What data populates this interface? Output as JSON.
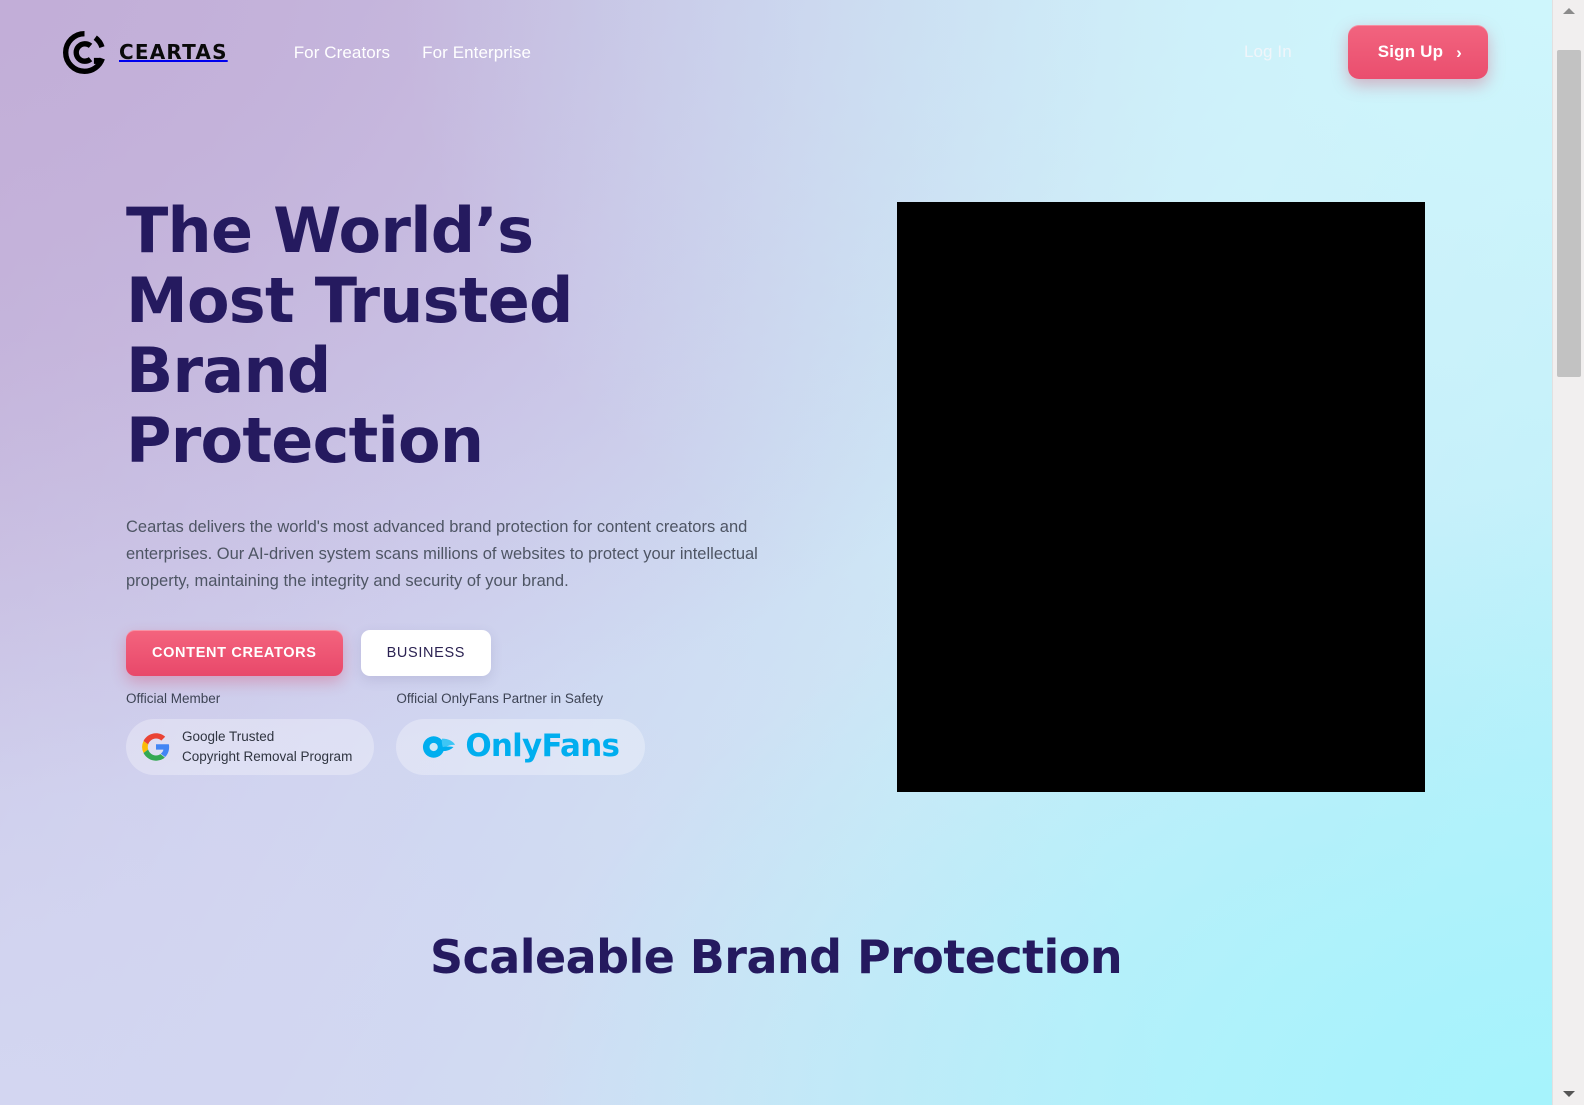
{
  "brand": {
    "name": "CEARTAS",
    "logo_icon": "ceartas-circular-c-logo"
  },
  "header": {
    "nav": [
      {
        "label": "For Creators",
        "name": "for-creators"
      },
      {
        "label": "For Enterprise",
        "name": "for-enterprise"
      }
    ],
    "login_label": "Log In",
    "signup_label": "Sign Up",
    "signup_chevron": "›"
  },
  "hero": {
    "title": "The World’s Most Trusted Brand Protection",
    "subtitle": "Ceartas delivers the world's most advanced brand protection for content creators and enterprises. Our AI-driven system scans millions of websites to protect your intellectual property, maintaining the integrity and security of your brand.",
    "cta_primary": "CONTENT CREATORS",
    "cta_secondary": "BUSINESS",
    "media_label": "hero-video-player"
  },
  "trust": {
    "google": {
      "caption": "Official Member",
      "line1": "Google Trusted",
      "line2": "Copyright Removal Program",
      "icon": "google-g-icon"
    },
    "onlyfans": {
      "caption": "Official OnlyFans Partner in Safety",
      "wordmark": "OnlyFans",
      "icon": "onlyfans-logo-icon"
    }
  },
  "sections": {
    "scaleable_title": "Scaleable Brand Protection"
  },
  "colors": {
    "accent_pink": "#ea4e6e",
    "heading_navy": "#251a5f",
    "onlyfans_blue": "#00aeef",
    "body_text": "#4e5564"
  },
  "scrollbar": {
    "up_arrow": "scroll-up-arrow",
    "down_arrow": "scroll-down-arrow"
  }
}
